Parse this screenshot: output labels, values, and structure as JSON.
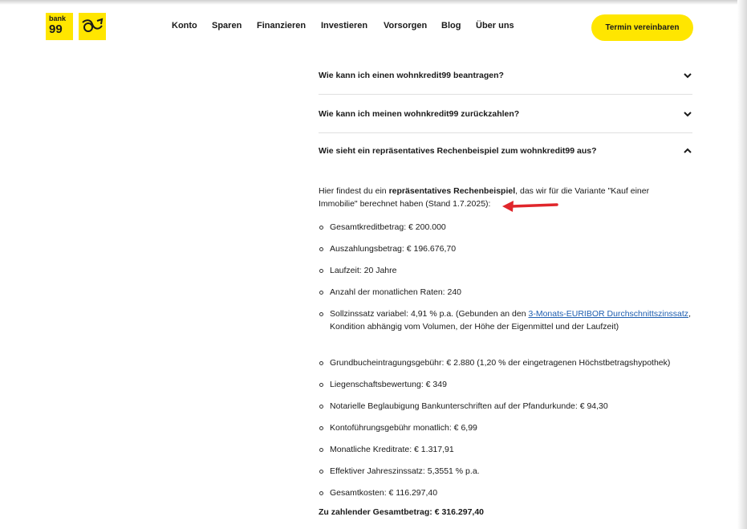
{
  "header": {
    "logo_line1": "bank",
    "logo_line2": "99",
    "nav": [
      "Konto",
      "Sparen",
      "Finanzieren",
      "Investieren",
      "Vorsorgen",
      "Blog",
      "Über uns"
    ],
    "cta_label": "Termin vereinbaren"
  },
  "faq": {
    "q1": "Wie kann ich einen wohnkredit99 beantragen?",
    "q2": "Wie kann ich meinen wohnkredit99 zurückzahlen?",
    "q3": "Wie sieht ein repräsentatives Rechenbeispiel zum wohnkredit99 aus?"
  },
  "answer": {
    "intro_pre": "Hier findest du ein ",
    "intro_bold": "repräsentatives Rechenbeispiel",
    "intro_post": ", das wir für die Variante \"Kauf einer Immobilie\" berechnet haben (Stand 1.7.2025):",
    "items": [
      "Gesamtkreditbetrag: € 200.000",
      "Auszahlungsbetrag: € 196.676,70",
      "Laufzeit: 20 Jahre",
      "Anzahl der monatlichen Raten: 240",
      "Sollzinssatz variabel: 4,91 % p.a. (Gebunden an den ",
      "Grundbucheintragungsgebühr: € 2.880 (1,20 % der eingetragenen Höchstbetragshypothek)",
      "Liegenschaftsbewertung: € 349",
      "Notarielle Beglaubigung Bankunterschriften auf der Pfandurkunde: € 94,30",
      "Kontoführungsgebühr monatlich: € 6,99",
      "Monatliche Kreditrate: € 1.317,91",
      "Effektiver Jahreszinssatz: 5,3551 % p.a.",
      "Gesamtkosten: € 116.297,40"
    ],
    "sollzins_link": "3-Monats-EURIBOR Durchschnittszinssatz",
    "sollzins_post": ", Kondition abhängig vom Volumen, der Höhe der Eigenmittel und der Laufzeit)",
    "total": "Zu zahlender Gesamtbetrag: € 316.297,40"
  },
  "colors": {
    "brand_yellow": "#ffe600",
    "link": "#1f5fb0",
    "annotation_arrow": "#e0262b"
  }
}
